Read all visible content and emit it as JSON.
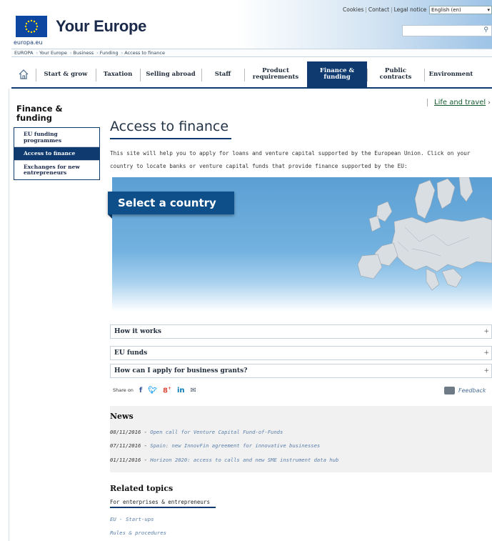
{
  "header": {
    "brand": "Your Europe",
    "europa_label": "europa.eu",
    "util_links": [
      "Cookies",
      "Contact",
      "Legal notice"
    ],
    "language": "English (en)",
    "search_placeholder": ""
  },
  "breadcrumb": [
    "EUROPA",
    "Your Europe",
    "Business",
    "Funding",
    "Access to finance"
  ],
  "nav": {
    "home_icon": "home-icon",
    "items": [
      {
        "label": "Start & grow"
      },
      {
        "label": "Taxation"
      },
      {
        "label": "Selling abroad"
      },
      {
        "label": "Staff"
      },
      {
        "label": "Product requirements"
      },
      {
        "label": "Finance & funding",
        "active": true
      },
      {
        "label": "Public contracts"
      },
      {
        "label": "Environment"
      }
    ]
  },
  "sidebar": {
    "title": "Finance & funding",
    "items": [
      {
        "label": "EU funding programmes"
      },
      {
        "label": "Access to finance",
        "active": true
      },
      {
        "label": "Exchanges for new entrepreneurs"
      }
    ]
  },
  "life_link": "Life and travel",
  "main": {
    "title": "Access to finance",
    "intro": "This site will help you to apply for loans and venture capital supported by the European Union. Click on your country to locate banks or venture capital funds that provide finance supported by the EU:",
    "select_country": "Select a country",
    "accordions": [
      "How it works",
      "EU funds",
      "How can I apply for business grants?"
    ],
    "share_label": "Share on",
    "feedback": "Feedback"
  },
  "news": {
    "title": "News",
    "items": [
      {
        "date": "08/11/2016",
        "text": "Open call for Venture Capital Fund-of-Funds"
      },
      {
        "date": "07/11/2016",
        "text": "Spain: new InnovFin agreement for innovative businesses"
      },
      {
        "date": "01/11/2016",
        "text": "Horizon 2020: access to calls and new SME instrument data hub"
      }
    ]
  },
  "related": {
    "title": "Related topics",
    "subtitle": "For enterprises & entrepreneurs",
    "links": [
      "EU - Start-ups",
      "Rules & procedures"
    ]
  },
  "colors": {
    "primary_navy": "#0e3a6f",
    "select_country_bg": "#0e4f8a",
    "link_blue": "#5a7faa",
    "life_link_green": "#145b2e"
  }
}
